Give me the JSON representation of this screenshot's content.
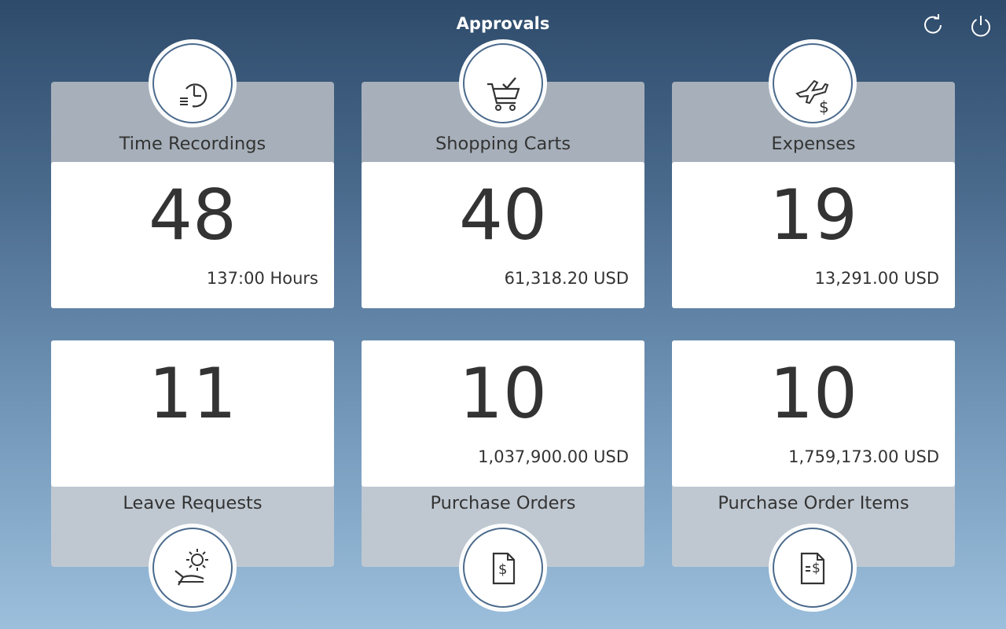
{
  "header": {
    "title": "Approvals",
    "refresh_icon": "refresh-icon",
    "power_icon": "power-icon"
  },
  "tiles": [
    {
      "label": "Time Recordings",
      "count": "48",
      "sub": "137:00 Hours",
      "icon": "clock-list-icon"
    },
    {
      "label": "Shopping Carts",
      "count": "40",
      "sub": "61,318.20 USD",
      "icon": "cart-check-icon"
    },
    {
      "label": "Expenses",
      "count": "19",
      "sub": "13,291.00 USD",
      "icon": "plane-dollar-icon"
    },
    {
      "label": "Leave Requests",
      "count": "11",
      "sub": "",
      "icon": "lounge-chair-sun-icon"
    },
    {
      "label": "Purchase Orders",
      "count": "10",
      "sub": "1,037,900.00 USD",
      "icon": "document-dollar-icon"
    },
    {
      "label": "Purchase Order Items",
      "count": "10",
      "sub": "1,759,173.00 USD",
      "icon": "document-lines-dollar-icon"
    }
  ],
  "colors": {
    "background_top": "#2e4b6b",
    "background_bottom": "#9cbfdc",
    "tile_header_top": "#a7b0ba",
    "tile_header_bottom": "#bfc8d1",
    "text": "#333333"
  }
}
